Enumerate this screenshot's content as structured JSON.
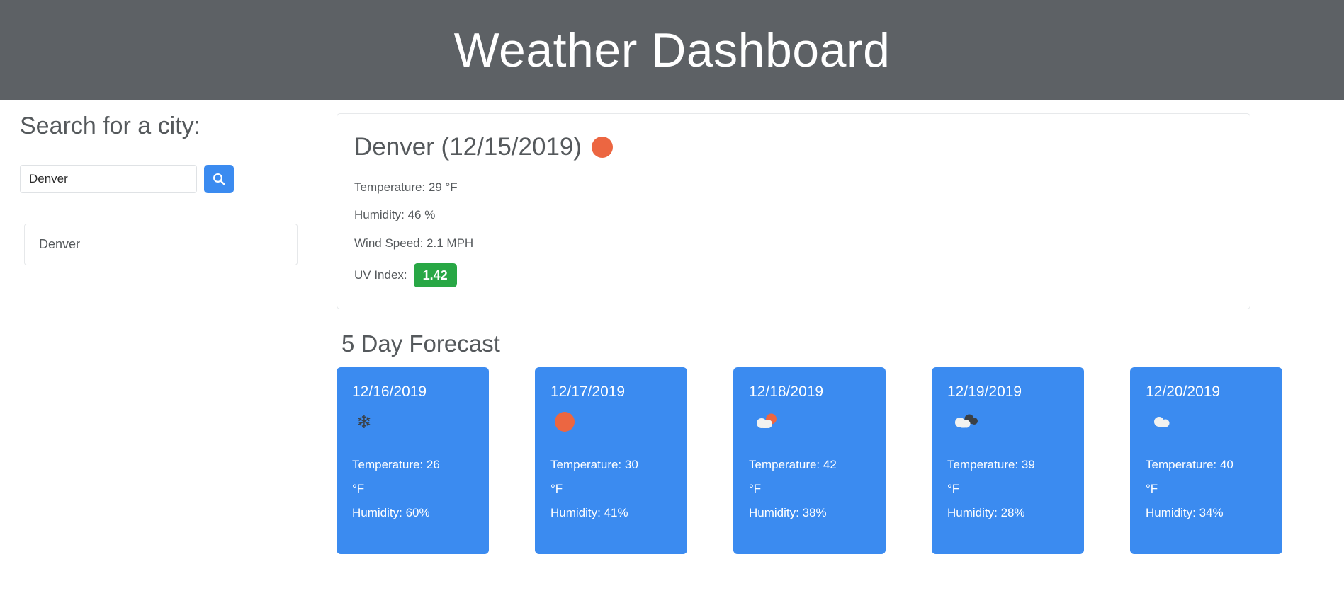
{
  "header": {
    "title": "Weather Dashboard",
    "background": "#5d6165"
  },
  "search": {
    "heading": "Search for a city:",
    "input_value": "Denver",
    "input_placeholder": "",
    "button_icon": "search-icon",
    "button_color": "#3b8bf0",
    "history": [
      "Denver"
    ]
  },
  "current": {
    "heading": "Denver (12/15/2019)",
    "icon": "sun-icon",
    "icon_color": "#ec6641",
    "temperature": "Temperature: 29 °F",
    "humidity": "Humidity: 46 %",
    "wind": "Wind Speed: 2.1 MPH",
    "uv_label": "UV Index:",
    "uv_value": "1.42",
    "uv_color": "#28a745"
  },
  "forecast": {
    "title": "5 Day Forecast",
    "card_color": "#3b8bf0",
    "days": [
      {
        "date": "12/16/2019",
        "icon": "snowflake-icon",
        "temperature": "Temperature: 26 °F",
        "humidity": "Humidity: 60%"
      },
      {
        "date": "12/17/2019",
        "icon": "sun-icon",
        "temperature": "Temperature: 30 °F",
        "humidity": "Humidity: 41%"
      },
      {
        "date": "12/18/2019",
        "icon": "sun-behind-cloud-icon",
        "temperature": "Temperature: 42 °F",
        "humidity": "Humidity: 38%"
      },
      {
        "date": "12/19/2019",
        "icon": "broken-clouds-icon",
        "temperature": "Temperature: 39 °F",
        "humidity": "Humidity: 28%"
      },
      {
        "date": "12/20/2019",
        "icon": "cloud-icon",
        "temperature": "Temperature: 40 °F",
        "humidity": "Humidity: 34%"
      }
    ]
  }
}
